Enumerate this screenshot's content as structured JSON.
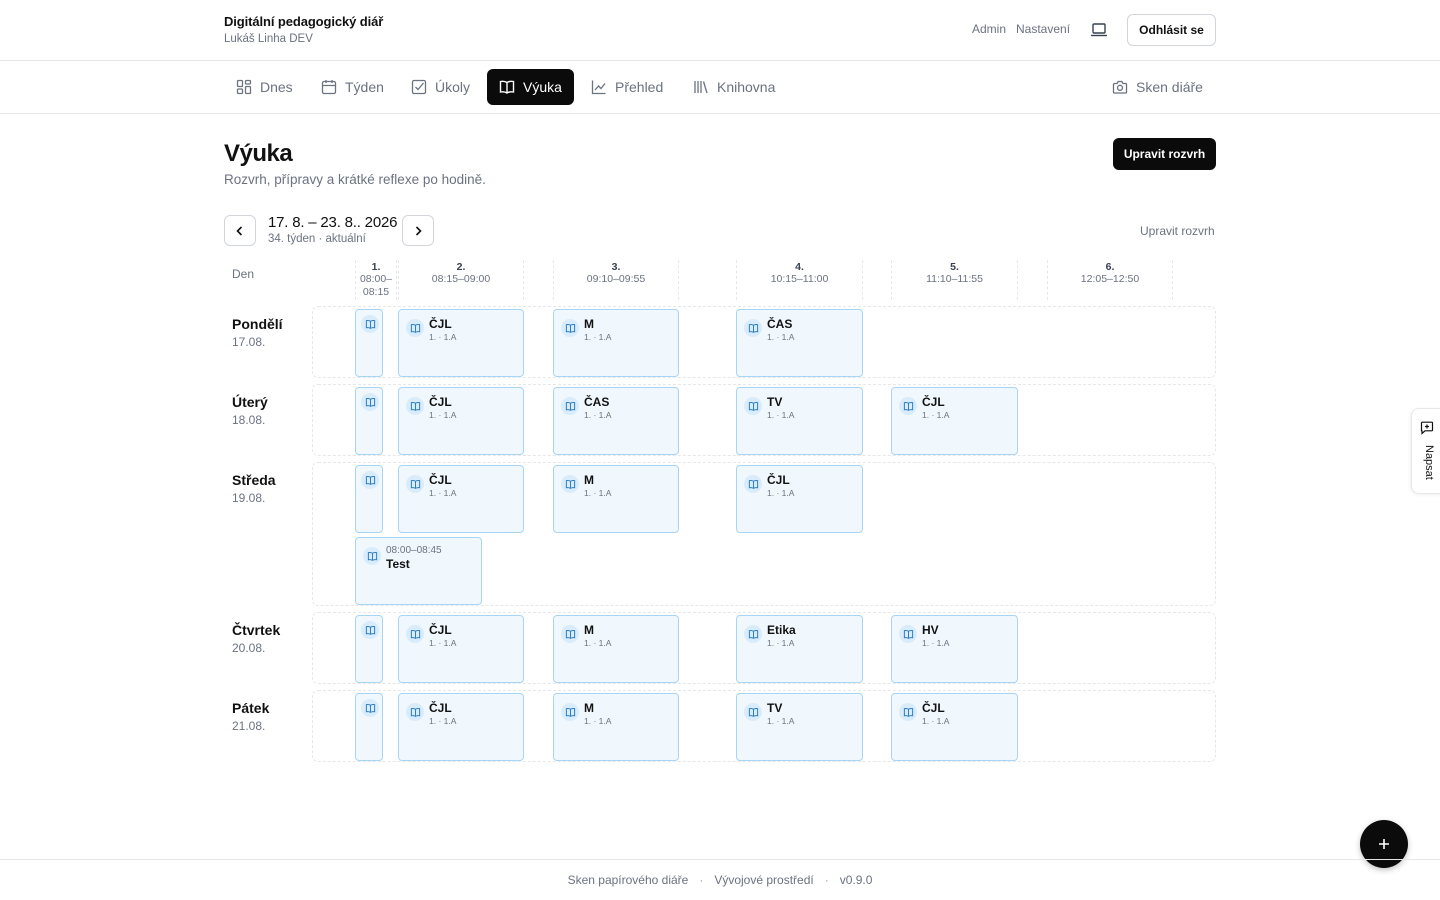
{
  "header": {
    "title": "Digitální pedagogický diář",
    "user": "Lukáš Linha DEV",
    "links": [
      "Admin",
      "Nastavení"
    ],
    "logout_label": "Odhlásit se"
  },
  "tabs": [
    {
      "label": "Dnes",
      "icon": "grid-icon"
    },
    {
      "label": "Týden",
      "icon": "calendar-icon"
    },
    {
      "label": "Úkoly",
      "icon": "checkbox-icon"
    },
    {
      "label": "Výuka",
      "icon": "book-icon",
      "active": true
    },
    {
      "label": "Přehled",
      "icon": "chart-icon"
    },
    {
      "label": "Knihovna",
      "icon": "library-icon"
    }
  ],
  "scan_tab": {
    "label": "Sken diáře",
    "icon": "camera-icon"
  },
  "page": {
    "title": "Výuka",
    "subtitle": "Rozvrh, přípravy a krátké reflexe po hodině.",
    "edit_button": "Upravit rozvrh"
  },
  "week": {
    "range": "17. 8. – 23. 8.. 2026",
    "subtitle": "34. týden · aktuální",
    "edit_link": "Upravit rozvrh"
  },
  "timetable": {
    "day_header": "Den",
    "periods": [
      {
        "number": "1.",
        "time_a": "08:00–",
        "time_b": "08:15"
      },
      {
        "number": "2.",
        "time_a": "08:15–09:00"
      },
      {
        "number": "3.",
        "time_a": "09:10–09:55"
      },
      {
        "number": "4.",
        "time_a": "10:15–11:00"
      },
      {
        "number": "5.",
        "time_a": "11:10–11:55"
      },
      {
        "number": "6.",
        "time_a": "12:05–12:50"
      }
    ],
    "days": [
      {
        "name": "Pondělí",
        "date": "17.08.",
        "lessons": [
          {
            "period": 1,
            "subject": "",
            "class": ""
          },
          {
            "period": 2,
            "subject": "ČJL",
            "class": "1. · 1.A"
          },
          {
            "period": 3,
            "subject": "M",
            "class": "1. · 1.A"
          },
          {
            "period": 4,
            "subject": "ČAS",
            "class": "1. · 1.A"
          }
        ]
      },
      {
        "name": "Úterý",
        "date": "18.08.",
        "lessons": [
          {
            "period": 1,
            "subject": "",
            "class": ""
          },
          {
            "period": 2,
            "subject": "ČJL",
            "class": "1. · 1.A"
          },
          {
            "period": 3,
            "subject": "ČAS",
            "class": "1. · 1.A"
          },
          {
            "period": 4,
            "subject": "TV",
            "class": "1. · 1.A"
          },
          {
            "period": 5,
            "subject": "ČJL",
            "class": "1. · 1.A"
          }
        ]
      },
      {
        "name": "Středa",
        "date": "19.08.",
        "lessons": [
          {
            "period": 1,
            "subject": "",
            "class": ""
          },
          {
            "period": 2,
            "subject": "ČJL",
            "class": "1. · 1.A"
          },
          {
            "period": 3,
            "subject": "M",
            "class": "1. · 1.A"
          },
          {
            "period": 4,
            "subject": "ČJL",
            "class": "1. · 1.A"
          }
        ],
        "event": {
          "time": "08:00–08:45",
          "title": "Test"
        }
      },
      {
        "name": "Čtvrtek",
        "date": "20.08.",
        "lessons": [
          {
            "period": 1,
            "subject": "",
            "class": ""
          },
          {
            "period": 2,
            "subject": "ČJL",
            "class": "1. · 1.A"
          },
          {
            "period": 3,
            "subject": "M",
            "class": "1. · 1.A"
          },
          {
            "period": 4,
            "subject": "Etika",
            "class": "1. · 1.A"
          },
          {
            "period": 5,
            "subject": "HV",
            "class": "1. · 1.A"
          }
        ]
      },
      {
        "name": "Pátek",
        "date": "21.08.",
        "lessons": [
          {
            "period": 1,
            "subject": "",
            "class": ""
          },
          {
            "period": 2,
            "subject": "ČJL",
            "class": "1. · 1.A"
          },
          {
            "period": 3,
            "subject": "M",
            "class": "1. · 1.A"
          },
          {
            "period": 4,
            "subject": "TV",
            "class": "1. · 1.A"
          },
          {
            "period": 5,
            "subject": "ČJL",
            "class": "1. · 1.A"
          }
        ]
      }
    ]
  },
  "feedback_label": "Napsat",
  "fab_icon": "plus-icon",
  "footer": {
    "items": [
      "Sken papírového diáře",
      "Vývojové prostředí",
      "v0.9.0"
    ],
    "separator": "·"
  },
  "colors": {
    "accent": "#0b0b0b",
    "lesson_bg": "#f0f8fe",
    "lesson_border": "#a9d5f5",
    "muted_text": "#6b7280"
  }
}
